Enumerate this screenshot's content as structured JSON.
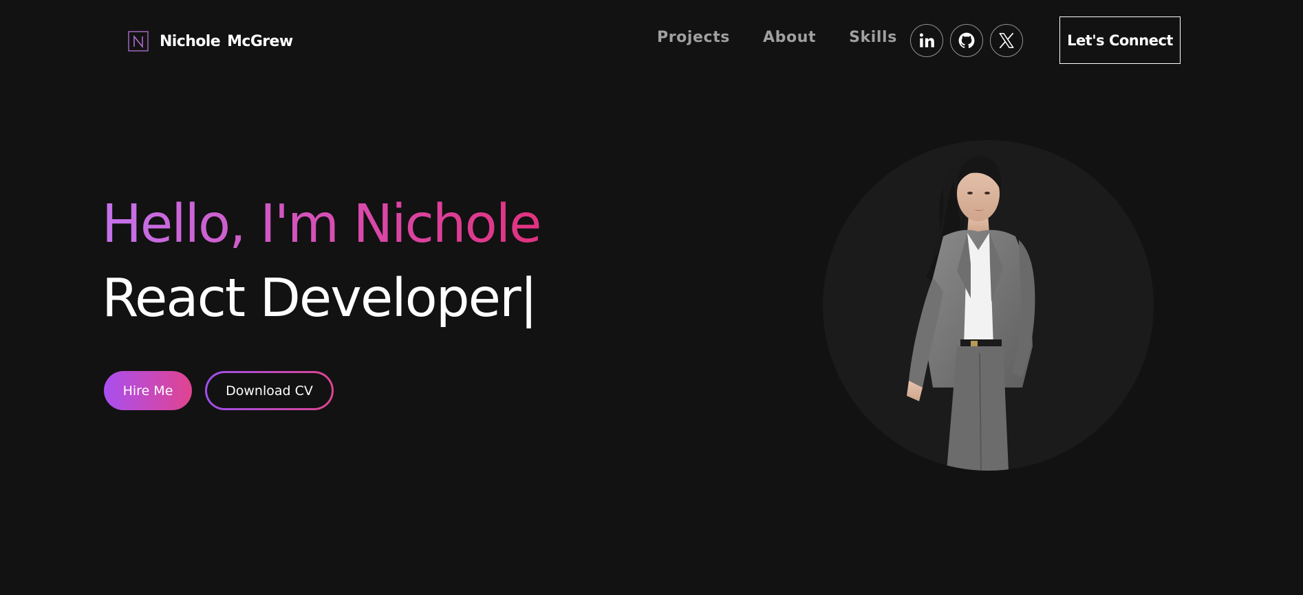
{
  "brand": {
    "logo_letter": "N",
    "name": "Nichole  McGrew"
  },
  "nav": {
    "links": [
      "Projects",
      "About",
      "Skills"
    ],
    "social_icons": [
      "linkedin-icon",
      "github-icon",
      "x-twitter-icon"
    ],
    "connect_label": "Let's Connect"
  },
  "hero": {
    "greeting": "Hello, I'm Nichole",
    "role": "React Developer",
    "cursor": "|",
    "hire_label": "Hire Me",
    "cv_label": "Download CV"
  },
  "colors": {
    "background": "#121212",
    "gradient_start": "#b05cf0",
    "gradient_end": "#e0448f",
    "nav_text": "#b9b9b9",
    "portrait_circle": "#1b1b1b"
  }
}
